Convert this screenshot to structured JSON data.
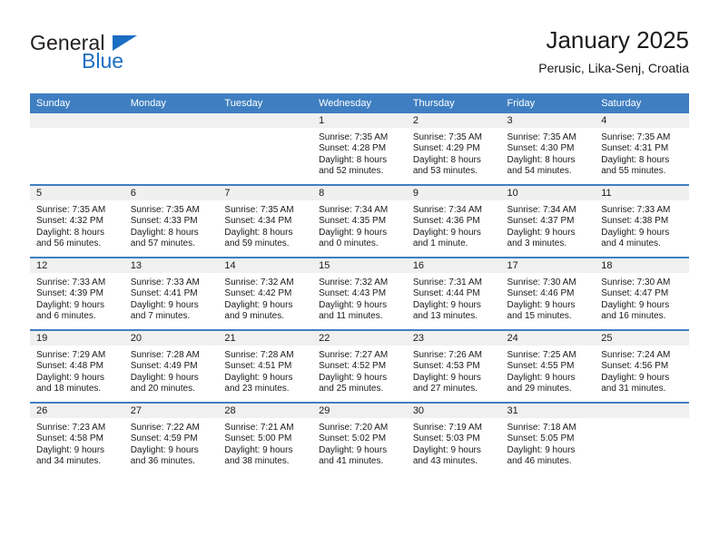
{
  "branding": {
    "logo_primary": "General",
    "logo_secondary": "Blue",
    "logo_icon": "triangle-icon",
    "logo_color": "#1b6ec2"
  },
  "header": {
    "title": "January 2025",
    "subtitle": "Perusic, Lika-Senj, Croatia"
  },
  "colors": {
    "header_row": "#3f7fc1",
    "daynum_band": "#f0f0f0",
    "text": "#1a1a1a"
  },
  "calendar": {
    "weekday_headers": [
      "Sunday",
      "Monday",
      "Tuesday",
      "Wednesday",
      "Thursday",
      "Friday",
      "Saturday"
    ],
    "weeks": [
      [
        {
          "day": "",
          "lines": []
        },
        {
          "day": "",
          "lines": []
        },
        {
          "day": "",
          "lines": []
        },
        {
          "day": "1",
          "lines": [
            "Sunrise: 7:35 AM",
            "Sunset: 4:28 PM",
            "Daylight: 8 hours",
            "and 52 minutes."
          ]
        },
        {
          "day": "2",
          "lines": [
            "Sunrise: 7:35 AM",
            "Sunset: 4:29 PM",
            "Daylight: 8 hours",
            "and 53 minutes."
          ]
        },
        {
          "day": "3",
          "lines": [
            "Sunrise: 7:35 AM",
            "Sunset: 4:30 PM",
            "Daylight: 8 hours",
            "and 54 minutes."
          ]
        },
        {
          "day": "4",
          "lines": [
            "Sunrise: 7:35 AM",
            "Sunset: 4:31 PM",
            "Daylight: 8 hours",
            "and 55 minutes."
          ]
        }
      ],
      [
        {
          "day": "5",
          "lines": [
            "Sunrise: 7:35 AM",
            "Sunset: 4:32 PM",
            "Daylight: 8 hours",
            "and 56 minutes."
          ]
        },
        {
          "day": "6",
          "lines": [
            "Sunrise: 7:35 AM",
            "Sunset: 4:33 PM",
            "Daylight: 8 hours",
            "and 57 minutes."
          ]
        },
        {
          "day": "7",
          "lines": [
            "Sunrise: 7:35 AM",
            "Sunset: 4:34 PM",
            "Daylight: 8 hours",
            "and 59 minutes."
          ]
        },
        {
          "day": "8",
          "lines": [
            "Sunrise: 7:34 AM",
            "Sunset: 4:35 PM",
            "Daylight: 9 hours",
            "and 0 minutes."
          ]
        },
        {
          "day": "9",
          "lines": [
            "Sunrise: 7:34 AM",
            "Sunset: 4:36 PM",
            "Daylight: 9 hours",
            "and 1 minute."
          ]
        },
        {
          "day": "10",
          "lines": [
            "Sunrise: 7:34 AM",
            "Sunset: 4:37 PM",
            "Daylight: 9 hours",
            "and 3 minutes."
          ]
        },
        {
          "day": "11",
          "lines": [
            "Sunrise: 7:33 AM",
            "Sunset: 4:38 PM",
            "Daylight: 9 hours",
            "and 4 minutes."
          ]
        }
      ],
      [
        {
          "day": "12",
          "lines": [
            "Sunrise: 7:33 AM",
            "Sunset: 4:39 PM",
            "Daylight: 9 hours",
            "and 6 minutes."
          ]
        },
        {
          "day": "13",
          "lines": [
            "Sunrise: 7:33 AM",
            "Sunset: 4:41 PM",
            "Daylight: 9 hours",
            "and 7 minutes."
          ]
        },
        {
          "day": "14",
          "lines": [
            "Sunrise: 7:32 AM",
            "Sunset: 4:42 PM",
            "Daylight: 9 hours",
            "and 9 minutes."
          ]
        },
        {
          "day": "15",
          "lines": [
            "Sunrise: 7:32 AM",
            "Sunset: 4:43 PM",
            "Daylight: 9 hours",
            "and 11 minutes."
          ]
        },
        {
          "day": "16",
          "lines": [
            "Sunrise: 7:31 AM",
            "Sunset: 4:44 PM",
            "Daylight: 9 hours",
            "and 13 minutes."
          ]
        },
        {
          "day": "17",
          "lines": [
            "Sunrise: 7:30 AM",
            "Sunset: 4:46 PM",
            "Daylight: 9 hours",
            "and 15 minutes."
          ]
        },
        {
          "day": "18",
          "lines": [
            "Sunrise: 7:30 AM",
            "Sunset: 4:47 PM",
            "Daylight: 9 hours",
            "and 16 minutes."
          ]
        }
      ],
      [
        {
          "day": "19",
          "lines": [
            "Sunrise: 7:29 AM",
            "Sunset: 4:48 PM",
            "Daylight: 9 hours",
            "and 18 minutes."
          ]
        },
        {
          "day": "20",
          "lines": [
            "Sunrise: 7:28 AM",
            "Sunset: 4:49 PM",
            "Daylight: 9 hours",
            "and 20 minutes."
          ]
        },
        {
          "day": "21",
          "lines": [
            "Sunrise: 7:28 AM",
            "Sunset: 4:51 PM",
            "Daylight: 9 hours",
            "and 23 minutes."
          ]
        },
        {
          "day": "22",
          "lines": [
            "Sunrise: 7:27 AM",
            "Sunset: 4:52 PM",
            "Daylight: 9 hours",
            "and 25 minutes."
          ]
        },
        {
          "day": "23",
          "lines": [
            "Sunrise: 7:26 AM",
            "Sunset: 4:53 PM",
            "Daylight: 9 hours",
            "and 27 minutes."
          ]
        },
        {
          "day": "24",
          "lines": [
            "Sunrise: 7:25 AM",
            "Sunset: 4:55 PM",
            "Daylight: 9 hours",
            "and 29 minutes."
          ]
        },
        {
          "day": "25",
          "lines": [
            "Sunrise: 7:24 AM",
            "Sunset: 4:56 PM",
            "Daylight: 9 hours",
            "and 31 minutes."
          ]
        }
      ],
      [
        {
          "day": "26",
          "lines": [
            "Sunrise: 7:23 AM",
            "Sunset: 4:58 PM",
            "Daylight: 9 hours",
            "and 34 minutes."
          ]
        },
        {
          "day": "27",
          "lines": [
            "Sunrise: 7:22 AM",
            "Sunset: 4:59 PM",
            "Daylight: 9 hours",
            "and 36 minutes."
          ]
        },
        {
          "day": "28",
          "lines": [
            "Sunrise: 7:21 AM",
            "Sunset: 5:00 PM",
            "Daylight: 9 hours",
            "and 38 minutes."
          ]
        },
        {
          "day": "29",
          "lines": [
            "Sunrise: 7:20 AM",
            "Sunset: 5:02 PM",
            "Daylight: 9 hours",
            "and 41 minutes."
          ]
        },
        {
          "day": "30",
          "lines": [
            "Sunrise: 7:19 AM",
            "Sunset: 5:03 PM",
            "Daylight: 9 hours",
            "and 43 minutes."
          ]
        },
        {
          "day": "31",
          "lines": [
            "Sunrise: 7:18 AM",
            "Sunset: 5:05 PM",
            "Daylight: 9 hours",
            "and 46 minutes."
          ]
        },
        {
          "day": "",
          "lines": []
        }
      ]
    ]
  }
}
